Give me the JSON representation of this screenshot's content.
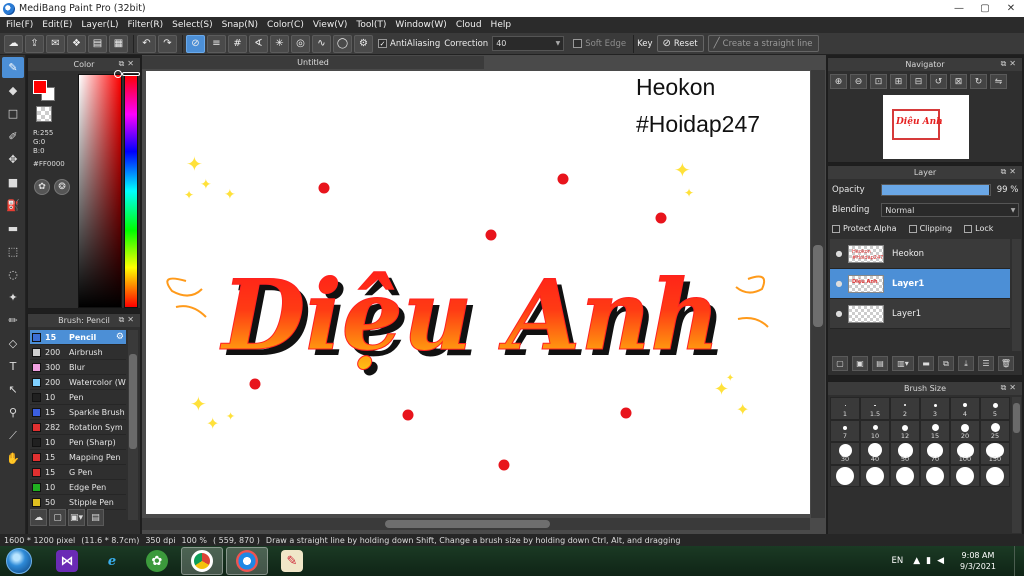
{
  "window": {
    "title": "MediBang Paint Pro (32bit)",
    "controls": [
      "—",
      "▢",
      "✕"
    ]
  },
  "menu": [
    "File(F)",
    "Edit(E)",
    "Layer(L)",
    "Filter(R)",
    "Select(S)",
    "Snap(N)",
    "Color(C)",
    "View(V)",
    "Tool(T)",
    "Window(W)",
    "Cloud",
    "Help"
  ],
  "toolbar": {
    "antialiasing_label": "AntiAliasing",
    "correction_label": "Correction",
    "correction_value": "40",
    "soft_edge_label": "Soft Edge",
    "key_label": "Key",
    "reset_label": "Reset",
    "straight_line_label": "Create a straight line"
  },
  "color_panel": {
    "title": "Color",
    "r": "R:255",
    "g": "G:0",
    "b": "B:0",
    "hex": "#FF0000",
    "fg_color": "#ff0000"
  },
  "brush_panel": {
    "title": "Brush: Pencil",
    "brushes": [
      {
        "size": "15",
        "name": "Pencil",
        "color": "#3b6fd6",
        "active": true
      },
      {
        "size": "200",
        "name": "Airbrush",
        "color": "#cfcfcf"
      },
      {
        "size": "300",
        "name": "Blur",
        "color": "#f0a0e0"
      },
      {
        "size": "200",
        "name": "Watercolor (W",
        "color": "#7fd0ff"
      },
      {
        "size": "10",
        "name": "Pen",
        "color": "#202020"
      },
      {
        "size": "15",
        "name": "Sparkle Brush",
        "color": "#3b5fe0"
      },
      {
        "size": "282",
        "name": "Rotation Sym",
        "color": "#e03030"
      },
      {
        "size": "10",
        "name": "Pen (Sharp)",
        "color": "#202020"
      },
      {
        "size": "15",
        "name": "Mapping Pen",
        "color": "#e03030"
      },
      {
        "size": "15",
        "name": "G Pen",
        "color": "#e03030"
      },
      {
        "size": "10",
        "name": "Edge Pen",
        "color": "#20b020"
      },
      {
        "size": "50",
        "name": "Stipple Pen",
        "color": "#e0c020"
      }
    ]
  },
  "canvas": {
    "tab_title": "Untitled",
    "text_line1": "Heokon",
    "text_line2": "#Hoidap247",
    "lettering": "Diệu Anh"
  },
  "navigator": {
    "title": "Navigator",
    "mini_text": "Diệu Anh"
  },
  "layer_panel": {
    "title": "Layer",
    "opacity_label": "Opacity",
    "opacity_value": "99 %",
    "opacity_fraction": 0.99,
    "blending_label": "Blending",
    "blending_value": "Normal",
    "protect_alpha": "Protect Alpha",
    "clipping": "Clipping",
    "lock": "Lock",
    "layers": [
      {
        "name": "Heokon",
        "thumb_text": "Heokon #Hoidap247",
        "active": false
      },
      {
        "name": "Layer1",
        "thumb_text": "Diệu Anh",
        "active": true
      },
      {
        "name": "Layer1",
        "thumb_text": "",
        "active": false
      }
    ]
  },
  "brush_size_panel": {
    "title": "Brush Size",
    "sizes": [
      "1",
      "1.5",
      "2",
      "3",
      "4",
      "5",
      "7",
      "10",
      "12",
      "15",
      "20",
      "25",
      "30",
      "40",
      "50",
      "70",
      "100",
      "150",
      "",
      "",
      "",
      "",
      "",
      ""
    ]
  },
  "status": {
    "dims": "1600 * 1200 pixel",
    "physical": "(11.6 * 8.7cm)",
    "dpi": "350 dpi",
    "zoom": "100 %",
    "coords": "( 559, 870 )",
    "hint": "Draw a straight line by holding down Shift, Change a brush size by holding down Ctrl, Alt, and dragging"
  },
  "taskbar": {
    "lang": "EN",
    "time": "9:08 AM",
    "date": "9/3/2021"
  }
}
